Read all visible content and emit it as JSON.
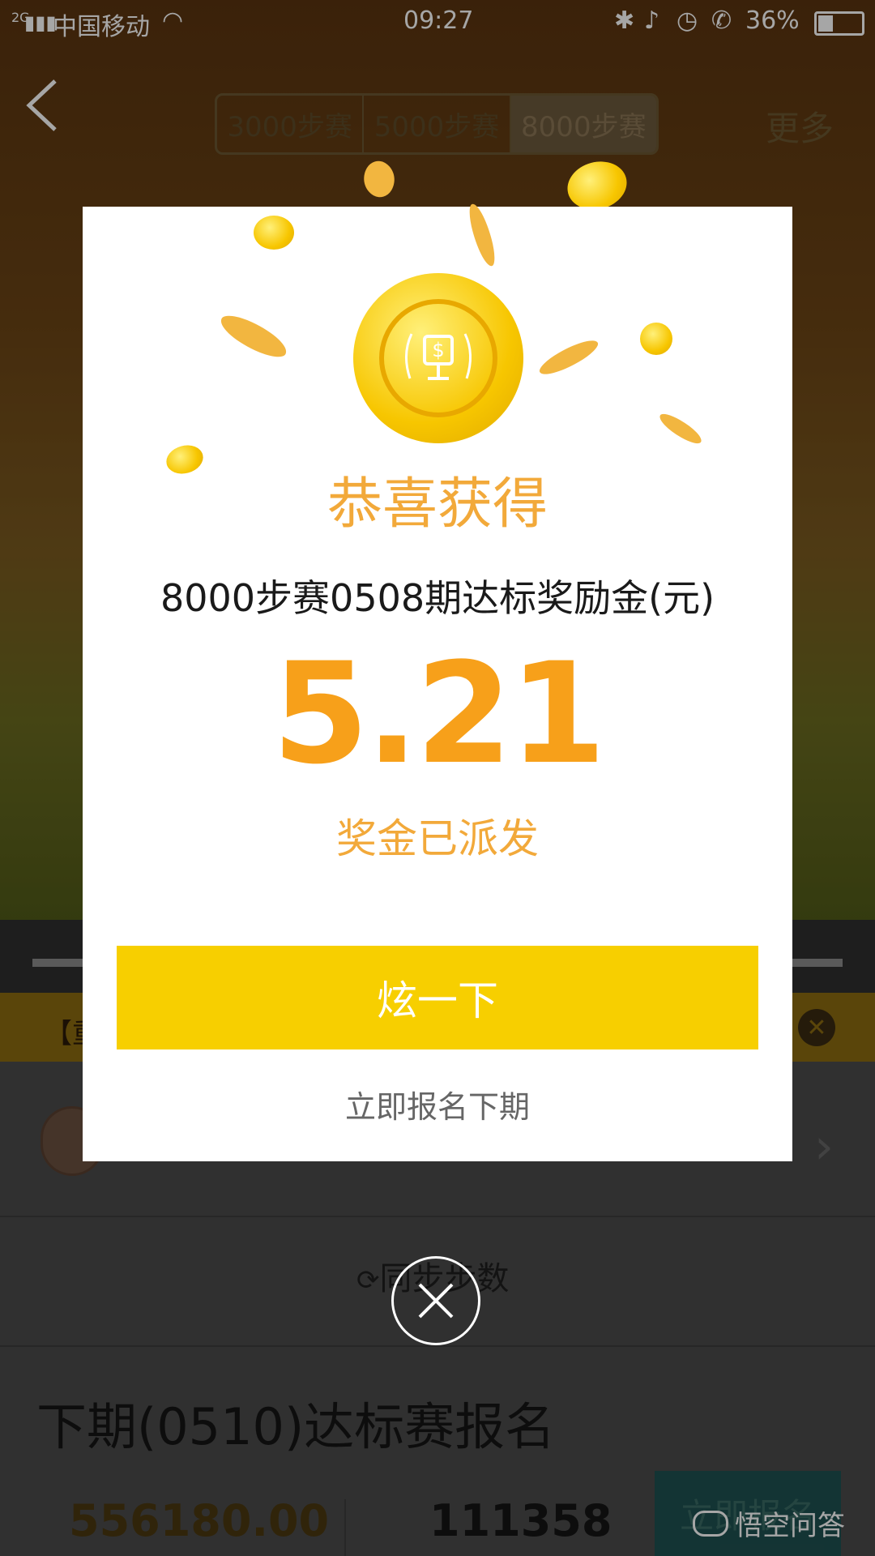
{
  "status_bar": {
    "network": "2G",
    "carrier": "中国移动",
    "time": "09:27",
    "battery": "36%"
  },
  "header": {
    "tabs": [
      "3000步赛",
      "5000步赛",
      "8000步赛"
    ],
    "more": "更多"
  },
  "background": {
    "notice_prefix": "【重",
    "sync_label": "同步步数",
    "next_title": "下期(0510)达标赛报名",
    "stat_pool": "556180.00",
    "stat_count": "111358",
    "signup_button": "立即报名",
    "watermark": "悟空问答"
  },
  "modal": {
    "title": "恭喜获得",
    "subtitle": "8000步赛0508期达标奖励金(元)",
    "amount": "5.21",
    "paid_status": "奖金已派发",
    "share_button": "炫一下",
    "next_link": "立即报名下期"
  },
  "colors": {
    "accent_orange": "#f7a01a",
    "button_yellow": "#f7cf00",
    "title_orange": "#f2a93a"
  }
}
